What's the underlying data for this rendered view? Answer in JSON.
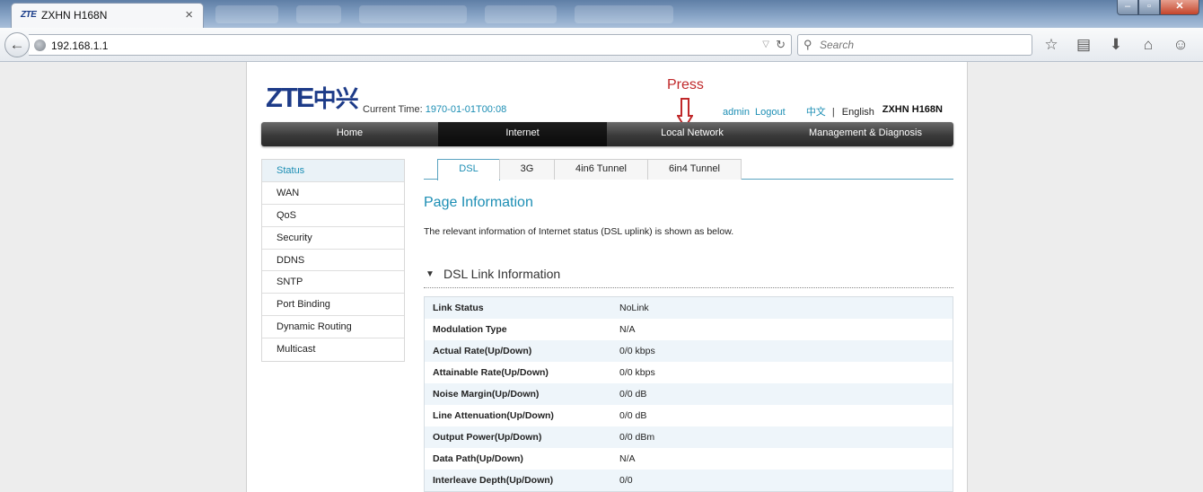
{
  "browser": {
    "tab_favicon": "ZTE",
    "tab_title": "ZXHN H168N",
    "tab_close": "×",
    "url": "192.168.1.1",
    "search_placeholder": "Search",
    "window_buttons": {
      "minimize": "–",
      "maximize": "▫",
      "close": "✕"
    },
    "icons": [
      "back-arrow-icon",
      "globe-icon",
      "reload-icon",
      "search-icon",
      "bookmark-star-icon",
      "reading-list-icon",
      "downloads-icon",
      "home-icon",
      "chat-icon"
    ]
  },
  "header": {
    "logo_latin": "ZTE",
    "logo_cn": "中兴",
    "current_time_label": "Current Time:",
    "current_time_value": "1970-01-01T00:08",
    "annotation": "Press",
    "user": "admin",
    "logout": "Logout",
    "lang_cn": "中文",
    "lang_sep": "|",
    "lang_en": "English",
    "model": "ZXHN H168N"
  },
  "mainnav": {
    "items": [
      "Home",
      "Internet",
      "Local Network",
      "Management & Diagnosis"
    ],
    "active": "Internet"
  },
  "sidemenu": {
    "items": [
      "Status",
      "WAN",
      "QoS",
      "Security",
      "DDNS",
      "SNTP",
      "Port Binding",
      "Dynamic Routing",
      "Multicast"
    ],
    "active": "Status"
  },
  "subtabs": {
    "items": [
      "DSL",
      "3G",
      "4in6 Tunnel",
      "6in4 Tunnel"
    ],
    "active": "DSL"
  },
  "content": {
    "page_title": "Page Information",
    "description": "The relevant information of Internet status (DSL uplink) is shown as below.",
    "section_title": "DSL Link Information",
    "table": [
      {
        "key": "Link Status",
        "value": "NoLink"
      },
      {
        "key": "Modulation Type",
        "value": "N/A"
      },
      {
        "key": "Actual Rate(Up/Down)",
        "value": "0/0 kbps"
      },
      {
        "key": "Attainable Rate(Up/Down)",
        "value": "0/0 kbps"
      },
      {
        "key": "Noise Margin(Up/Down)",
        "value": "0/0 dB"
      },
      {
        "key": "Line Attenuation(Up/Down)",
        "value": "0/0 dB"
      },
      {
        "key": "Output Power(Up/Down)",
        "value": "0/0 dBm"
      },
      {
        "key": "Data Path(Up/Down)",
        "value": "N/A"
      },
      {
        "key": "Interleave Depth(Up/Down)",
        "value": "0/0"
      }
    ]
  },
  "colors": {
    "link": "#1c8eb4",
    "annotation": "#c0282a",
    "nav_dark": "#2a2a2a",
    "logo": "#1d3b88"
  }
}
